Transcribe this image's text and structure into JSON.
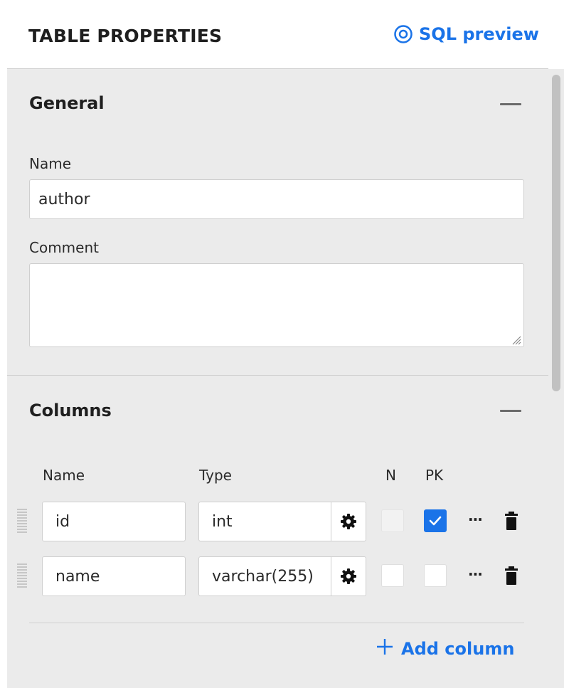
{
  "header": {
    "title": "TABLE PROPERTIES",
    "sql_preview_label": "SQL preview",
    "sql_preview_icon": "eye-icon"
  },
  "general": {
    "title": "General",
    "name_label": "Name",
    "name_value": "author",
    "comment_label": "Comment",
    "comment_value": ""
  },
  "columns": {
    "title": "Columns",
    "headers": {
      "name": "Name",
      "type": "Type",
      "nullable": "N",
      "primary_key": "PK"
    },
    "rows": [
      {
        "name": "id",
        "type": "int",
        "nullable": false,
        "nullable_disabled": true,
        "primary_key": true
      },
      {
        "name": "name",
        "type": "varchar(255)",
        "nullable": false,
        "nullable_disabled": false,
        "primary_key": false
      }
    ],
    "more_label": "···",
    "add_label": "Add column"
  },
  "colors": {
    "accent": "#1a73e8",
    "panel": "#ebebeb"
  }
}
